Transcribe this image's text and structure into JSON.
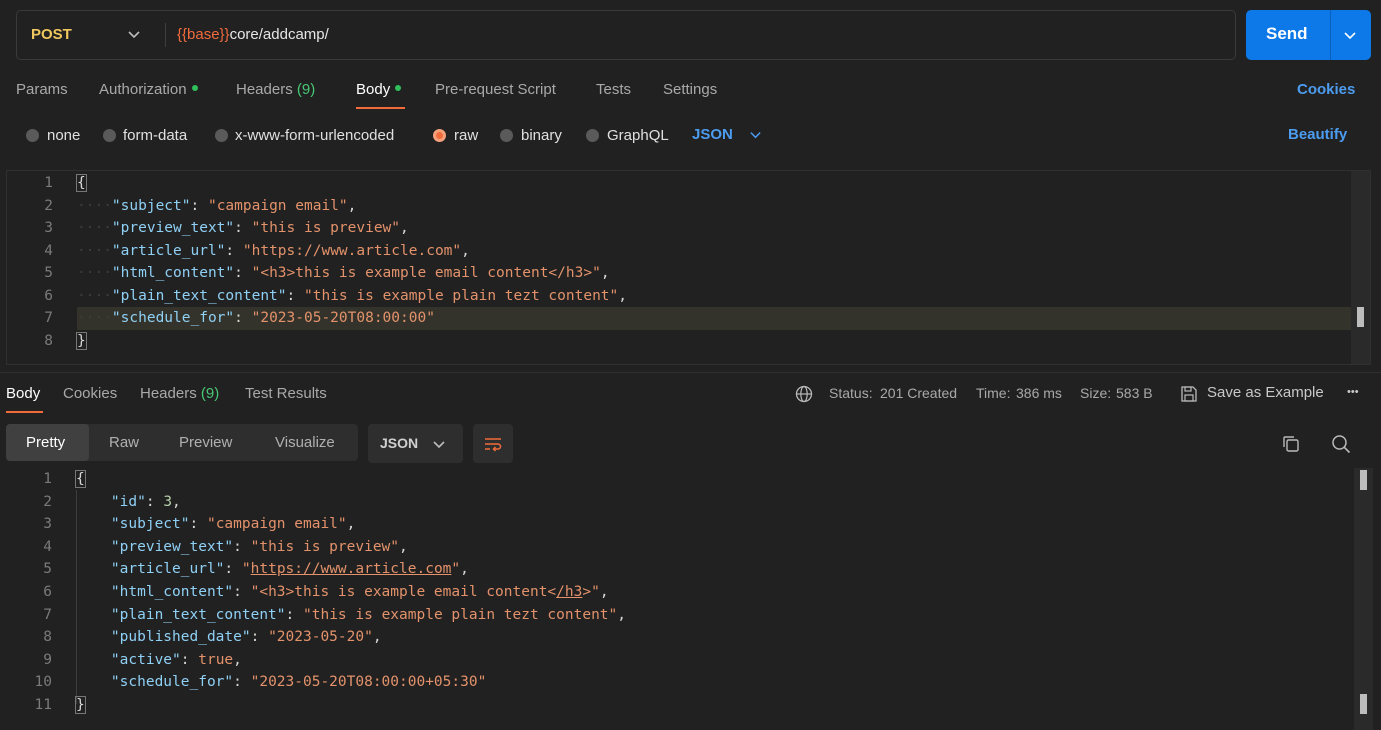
{
  "request": {
    "method": "POST",
    "url_var": "{{base}}",
    "url_path": "core/addcamp/",
    "send_label": "Send"
  },
  "req_tabs": {
    "params": "Params",
    "authorization": "Authorization",
    "headers": "Headers",
    "headers_count": "(9)",
    "body": "Body",
    "prerequest": "Pre-request Script",
    "tests": "Tests",
    "settings": "Settings",
    "cookies": "Cookies"
  },
  "body_types": {
    "none": "none",
    "form_data": "form-data",
    "urlencoded": "x-www-form-urlencoded",
    "raw": "raw",
    "binary": "binary",
    "graphql": "GraphQL",
    "selected": "raw",
    "format": "JSON",
    "beautify": "Beautify"
  },
  "request_body": {
    "subject": "\"subject\"",
    "subject_val": "\"campaign email\"",
    "preview_text": "\"preview_text\"",
    "preview_text_val": "\"this is preview\"",
    "article_url": "\"article_url\"",
    "article_url_val": "\"https://www.article.com\"",
    "html_content": "\"html_content\"",
    "html_content_val": "\"<h3>this is example email content</h3>\"",
    "plain_text_content": "\"plain_text_content\"",
    "plain_text_content_val": "\"this is example plain tezt content\"",
    "schedule_for": "\"schedule_for\"",
    "schedule_for_val": "\"2023-05-20T08:00:00\""
  },
  "response_tabs": {
    "body": "Body",
    "cookies": "Cookies",
    "headers": "Headers",
    "headers_count": "(9)",
    "test_results": "Test Results"
  },
  "response_meta": {
    "status_label": "Status:",
    "status_value": "201 Created",
    "time_label": "Time:",
    "time_value": "386 ms",
    "size_label": "Size:",
    "size_value": "583 B",
    "save_example": "Save as Example",
    "more": "•••"
  },
  "view_modes": {
    "pretty": "Pretty",
    "raw": "Raw",
    "preview": "Preview",
    "visualize": "Visualize",
    "format": "JSON"
  },
  "response_body": {
    "id": "\"id\"",
    "id_val": "3",
    "subject": "\"subject\"",
    "subject_val": "\"campaign email\"",
    "preview_text": "\"preview_text\"",
    "preview_text_val": "\"this is preview\"",
    "article_url": "\"article_url\"",
    "article_url_q": "\"",
    "article_url_link": "https://www.article.com",
    "html_content": "\"html_content\"",
    "html_content_a": "\"<h3>this is example email content<",
    "html_content_u": "/h3",
    "html_content_b": ">\"",
    "plain_text_content": "\"plain_text_content\"",
    "plain_text_content_val": "\"this is example plain tezt content\"",
    "published_date": "\"published_date\"",
    "published_date_val": "\"2023-05-20\"",
    "active": "\"active\"",
    "active_val": "true",
    "schedule_for": "\"schedule_for\"",
    "schedule_for_val": "\"2023-05-20T08:00:00+05:30\""
  },
  "colors": {
    "accent": "#f26b3a",
    "send_blue": "#0d78e7",
    "link_blue": "#4c9cf0",
    "success_green": "#48c774"
  }
}
